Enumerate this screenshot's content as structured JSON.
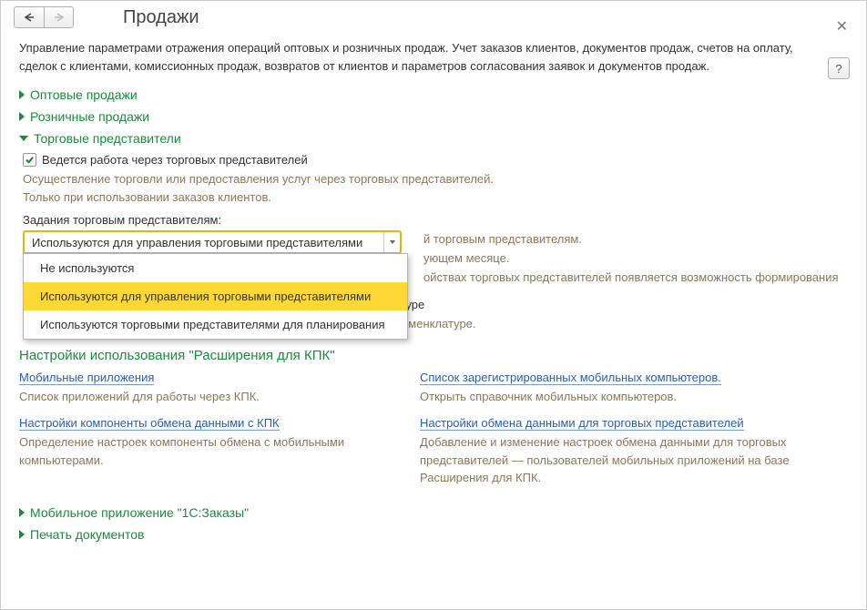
{
  "title": "Продажи",
  "description": "Управление параметрами отражения операций оптовых и розничных продаж. Учет заказов клиентов, документов продаж, счетов на оплату, сделок с клиентами, комиссионных продаж, возвратов от клиентов и параметров согласования заявок и документов продаж.",
  "sections": {
    "wholesale": "Оптовые продажи",
    "retail": "Розничные продажи",
    "reps": "Торговые представители",
    "mobile_app": "Мобильное приложение \"1С:Заказы\"",
    "print_docs": "Печать документов"
  },
  "reps": {
    "cb1_label": "Ведется работа через торговых представителей",
    "hint1_line1": "Осуществление торговли или предоставления услуг через торговых представителей.",
    "hint1_line2": "Только при использовании заказов клиентов.",
    "tasks_label": "Задания торговым представителям:",
    "dropdown_value": "Используются для управления торговыми представителями",
    "options": {
      "o1": "Не используются",
      "o2": "Используются для управления торговыми представителями",
      "o3": "Используются торговыми представителями для планирования"
    },
    "bg1": "й торговым представителям.",
    "bg2": "ующем месяце.",
    "bg3": "ойствах торговых представителей появляется возможность формирования",
    "cb2_label": "Детализировать задания торговым представителям по номенклатуре",
    "hint2": "Формирование заданий с указанием планов продаж по конкретной номенклатуре."
  },
  "kpk": {
    "title": "Настройки использования \"Расширения для КПК\"",
    "left1_link": "Мобильные приложения",
    "left1_hint": "Список приложений для работы через КПК.",
    "left2_link": "Настройки компоненты обмена данными с КПК",
    "left2_hint": "Определение настроек компоненты обмена с мобильными компьютерами.",
    "right1_link": "Список зарегистрированных мобильных компьютеров.",
    "right1_hint": "Открыть справочник мобильных компьютеров.",
    "right2_link": "Настройки обмена данными для торговых представителей",
    "right2_hint": "Добавление и изменение настроек обмена данными для торговых представителей — пользователей мобильных приложений на базе Расширения для КПК."
  }
}
